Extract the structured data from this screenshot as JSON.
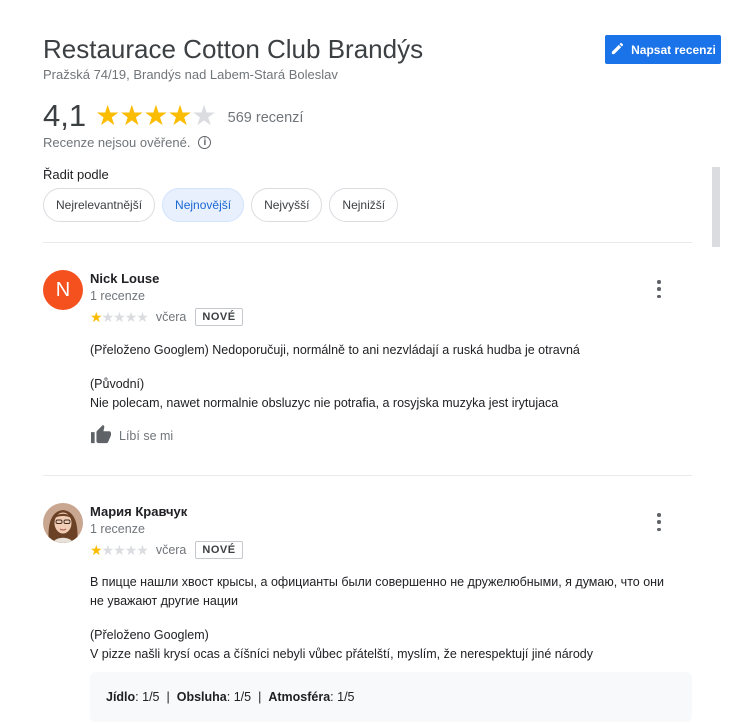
{
  "header": {
    "title": "Restaurace Cotton Club Brandýs",
    "address": "Pražská 74/19, Brandýs nad Labem-Stará Boleslav",
    "write_review_label": "Napsat recenzi",
    "write_review_icon": "pencil-icon"
  },
  "rating": {
    "value": "4,1",
    "stars": 4,
    "count_label": "569 recenzí",
    "unverified_note": "Recenze nejsou ověřené.",
    "info_icon": "i"
  },
  "sort": {
    "label": "Řadit podle",
    "options": [
      "Nejrelevantnější",
      "Nejnovější",
      "Nejvyšší",
      "Nejnižší"
    ],
    "active": "Nejnovější"
  },
  "reviews": [
    {
      "name": "Nick Louse",
      "avatar_letter": "N",
      "avatar_color": "#f4511e",
      "count": "1 recenze",
      "stars": 1,
      "date": "včera",
      "badge": "NOVÉ",
      "translated_text": "(Přeloženo Googlem) Nedoporučuji, normálně to ani nezvládají a ruská hudba je otravná",
      "original_label": "(Původní)",
      "original_text": "Nie polecam, nawet normalnie obsluzyc nie potrafia, a rosyjska muzyka jest irytujaca",
      "like_label": "Líbí se mi"
    },
    {
      "name": "Мария Кравчук",
      "count": "1 recenze",
      "stars": 1,
      "date": "včera",
      "badge": "NOVÉ",
      "text_line1": "В пицце нашли хвост крысы, а официанты были совершенно не дружелюбными, я думаю, что они",
      "text_line2": "не уважают другие нации",
      "translated_label": "(Přeloženo Googlem)",
      "translated_text": "V pizze našli krysí ocas a číšníci nebyli vůbec přátelští, myslím, že nerespektují jiné národy",
      "attributes": [
        {
          "label": "Jídlo",
          "value": ": 1/5"
        },
        {
          "label": "Obsluha",
          "value": ": 1/5"
        },
        {
          "label": "Atmosféra",
          "value": ": 1/5"
        }
      ]
    }
  ]
}
